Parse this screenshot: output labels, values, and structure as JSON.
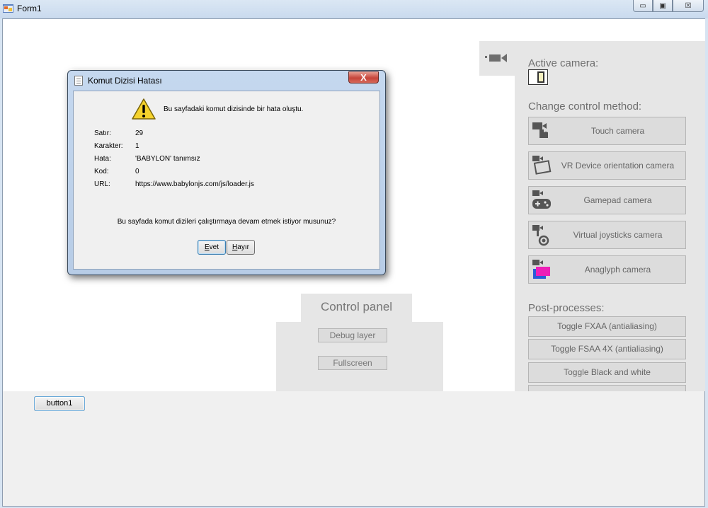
{
  "window": {
    "title": "Form1",
    "minimize": "▭",
    "maximize": "▣",
    "close": "☒"
  },
  "right_panel": {
    "active_camera_label": "Active camera:",
    "change_control_label": "Change control method:",
    "cameras": [
      {
        "label": "Touch camera",
        "icon": "touch-camera-icon"
      },
      {
        "label": "VR Device orientation camera",
        "icon": "vr-orientation-camera-icon"
      },
      {
        "label": "Gamepad camera",
        "icon": "gamepad-camera-icon"
      },
      {
        "label": "Virtual joysticks camera",
        "icon": "virtual-joystick-camera-icon"
      },
      {
        "label": "Anaglyph camera",
        "icon": "anaglyph-camera-icon"
      }
    ],
    "post_processes_label": "Post-processes:",
    "post_processes": [
      "Toggle FXAA (antialiasing)",
      "Toggle FSAA 4X (antialiasing)",
      "Toggle Black and white"
    ]
  },
  "control_panel": {
    "title": "Control panel",
    "debug_layer": "Debug layer",
    "fullscreen": "Fullscreen"
  },
  "form": {
    "button1": "button1"
  },
  "dialog": {
    "title": "Komut Dizisi Hatası",
    "close": "X",
    "message": "Bu sayfadaki komut dizisinde bir hata oluştu.",
    "details": [
      {
        "key": "Satır:",
        "value": "29"
      },
      {
        "key": "Karakter:",
        "value": "1"
      },
      {
        "key": "Hata:",
        "value": "'BABYLON' tanımsız"
      },
      {
        "key": "Kod:",
        "value": "0"
      },
      {
        "key": "URL:",
        "value": "https://www.babylonjs.com/js/loader.js"
      }
    ],
    "question": "Bu sayfada komut dizileri çalıştırmaya devam etmek istiyor musunuz?",
    "yes_rest": "vet",
    "yes_mnemonic": "E",
    "no_rest": "ayır",
    "no_mnemonic": "H"
  },
  "colors": {
    "panel_bg": "#e6e6e6",
    "button_bg": "#dcdcdc",
    "dialog_frame": "#b7cce6",
    "close_red": "#c6443a"
  }
}
